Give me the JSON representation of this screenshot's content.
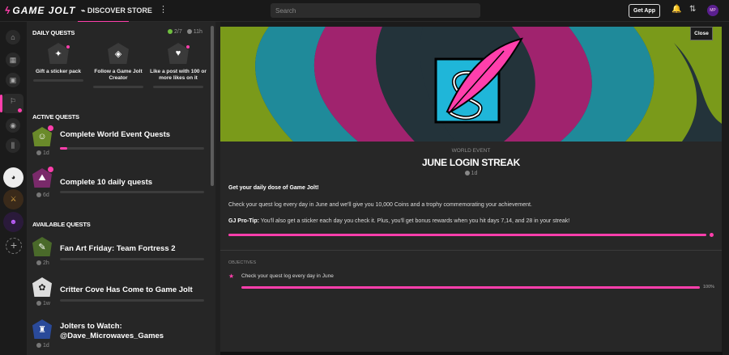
{
  "topbar": {
    "logo_text": "GAME JOLT",
    "nav_discover": "DISCOVER",
    "nav_store": "STORE",
    "more_icon": "⋮",
    "search_placeholder": "Search",
    "get_app_label": "Get App",
    "avatar_text": "MP"
  },
  "daily": {
    "title": "DAILY QUESTS",
    "progress": "2/7",
    "time_left": "11h",
    "cards": [
      {
        "label": "Gift a sticker pack",
        "icon": "sticker-pack-icon"
      },
      {
        "label": "Follow a Game Jolt Creator",
        "icon": "creator-icon"
      },
      {
        "label": "Like a post with 100 or more likes on it",
        "icon": "heart-icon"
      }
    ]
  },
  "active": {
    "title": "ACTIVE QUESTS",
    "items": [
      {
        "title": "Complete World Event Quests",
        "time": "1d",
        "progress": 0.05
      },
      {
        "title": "Complete 10 daily quests",
        "time": "6d",
        "progress": 0
      }
    ]
  },
  "available": {
    "title": "AVAILABLE QUESTS",
    "items": [
      {
        "title": "Fan Art Friday: Team Fortress 2",
        "time": "2h"
      },
      {
        "title": "Critter Cove Has Come to Game Jolt",
        "time": "1w"
      },
      {
        "title": "Jolters to Watch: @Dave_Microwaves_Games",
        "time": "1d"
      }
    ]
  },
  "modal": {
    "close_label": "Close",
    "event_type": "WORLD EVENT",
    "event_title": "JUNE LOGIN STREAK",
    "event_time": "1d",
    "intro": "Get your daily dose of Game Jolt!",
    "body": "Check your quest log every day in June and we'll give you 10,000 Coins and a trophy commemorating your achievement.",
    "protip_label": "GJ Pro-Tip:",
    "protip": " You'll also get a sticker each day you check it. Plus, you'll get bonus rewards when you hit days 7,14, and 28 in your streak!",
    "objectives_label": "OBJECTIVES",
    "objective_text": "Check your quest log every day in June",
    "objective_percent": "100%"
  },
  "colors": {
    "accent": "#ff3fac",
    "banner_green": "#7a9a1a",
    "banner_teal": "#1f8a9a",
    "banner_magenta": "#a0236e",
    "banner_dark": "#23333a"
  }
}
